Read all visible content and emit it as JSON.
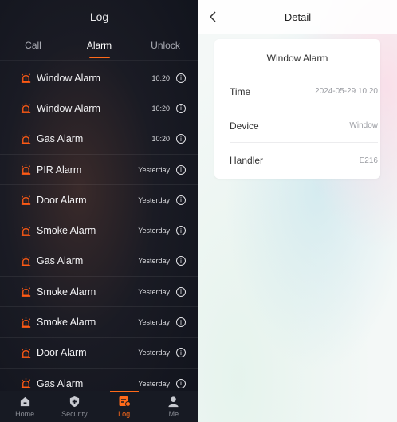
{
  "left": {
    "title": "Log",
    "tabs": [
      {
        "label": "Call",
        "active": false
      },
      {
        "label": "Alarm",
        "active": true
      },
      {
        "label": "Unlock",
        "active": false
      }
    ],
    "rows": [
      {
        "label": "Window Alarm",
        "time": "10:20"
      },
      {
        "label": "Window Alarm",
        "time": "10:20"
      },
      {
        "label": "Gas Alarm",
        "time": "10:20"
      },
      {
        "label": "PIR Alarm",
        "time": "Yesterday"
      },
      {
        "label": "Door Alarm",
        "time": "Yesterday"
      },
      {
        "label": "Smoke Alarm",
        "time": "Yesterday"
      },
      {
        "label": "Gas Alarm",
        "time": "Yesterday"
      },
      {
        "label": "Smoke Alarm",
        "time": "Yesterday"
      },
      {
        "label": "Smoke Alarm",
        "time": "Yesterday"
      },
      {
        "label": "Door Alarm",
        "time": "Yesterday"
      },
      {
        "label": "Gas Alarm",
        "time": "Yesterday"
      }
    ],
    "info_glyph": "i",
    "nav": [
      {
        "label": "Home",
        "icon": "home-icon"
      },
      {
        "label": "Security",
        "icon": "shield-icon"
      },
      {
        "label": "Log",
        "icon": "log-icon",
        "active": true
      },
      {
        "label": "Me",
        "icon": "user-icon"
      }
    ],
    "accent_color": "#ff6a1a"
  },
  "right": {
    "title": "Detail",
    "card_title": "Window Alarm",
    "details": [
      {
        "label": "Time",
        "value": "2024-05-29 10:20"
      },
      {
        "label": "Device",
        "value": "Window"
      },
      {
        "label": "Handler",
        "value": "E216"
      }
    ]
  }
}
